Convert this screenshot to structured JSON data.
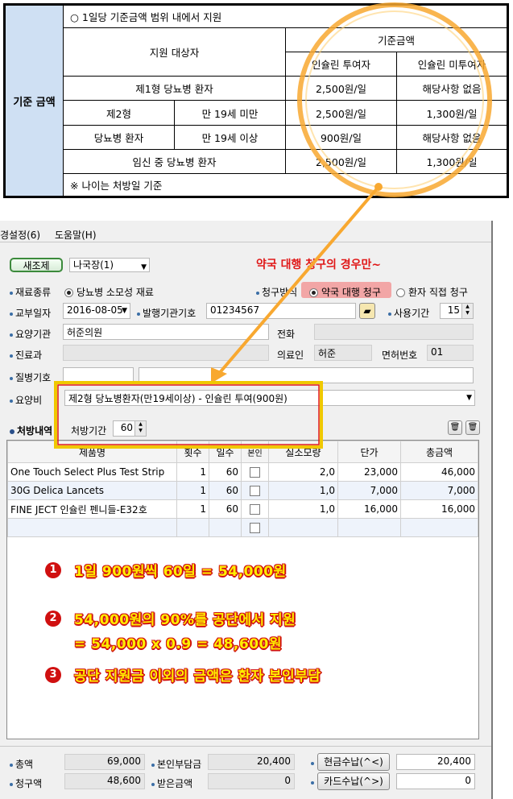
{
  "ref_table": {
    "side_label": "기준 금액",
    "note_top": "○ 1일당 기준금액 범위 내에서 지원",
    "header_target": "지원 대상자",
    "header_amount": "기준금액",
    "header_insulin_given": "인슐린 투여자",
    "header_insulin_not": "인슐린 미투여자",
    "rows": [
      {
        "a": "제1형 당뇨병 환자",
        "b": "",
        "c": "2,500원/일",
        "d": "해당사항 없음"
      },
      {
        "a": "제2형",
        "b": "만 19세 미만",
        "c": "2,500원/일",
        "d": "1,300원/일"
      },
      {
        "a": "당뇨병 환자",
        "b": "만 19세 이상",
        "c": "900원/일",
        "d": "해당사항 없음"
      },
      {
        "a": "임신 중 당뇨병 환자",
        "b": "",
        "c": "2,500원/일",
        "d": "1,300원/일"
      }
    ],
    "note_bottom": "※ 나이는 처방일 기준"
  },
  "menu": {
    "item1": "경설정(6)",
    "item2": "도움말(H)"
  },
  "toolbar": {
    "new_button": "새조제",
    "pharmacist": "나국장(1)"
  },
  "annotation_top": "약국 대행 청구의 경우만~",
  "form": {
    "material_type_label": "재료종류",
    "material_type_value": "당뇨병 소모성 재료",
    "claim_method_label": "청구방식",
    "claim_option1": "약국 대행 청구",
    "claim_option2": "환자 직접 청구",
    "issue_date_label": "교부일자",
    "issue_date": "2016-08-05",
    "issuer_code_label": "발행기관기호",
    "issuer_code": "01234567",
    "usage_period_label": "사용기간",
    "usage_period": "15",
    "institution_label": "요양기관",
    "institution": "허준의원",
    "phone_label": "전화",
    "phone": "",
    "department_label": "진료과",
    "department": "",
    "doctor_label": "의료인",
    "doctor": "허준",
    "license_label": "면허번호",
    "license": "01",
    "disease_label": "질병기호",
    "disease": "",
    "cost_label": "요양비",
    "cost_value": "제2형 당뇨병환자(만19세이상) - 인슐린 투여(900원)"
  },
  "rx": {
    "section_label": "처방내역",
    "period_label": "처방기간",
    "period_value": "60"
  },
  "grid": {
    "headers": [
      "제품명",
      "횟수",
      "일수",
      "본인",
      "실소모량",
      "단가",
      "총금액"
    ],
    "rows": [
      {
        "name": "One Touch Select Plus Test Strip",
        "times": "1",
        "days": "60",
        "qty": "2,0",
        "price": "23,000",
        "total": "46,000"
      },
      {
        "name": "30G Delica Lancets",
        "times": "1",
        "days": "60",
        "qty": "1,0",
        "price": "7,000",
        "total": "7,000"
      },
      {
        "name": "FINE JECT 인슐린 펜니들-E32호",
        "times": "1",
        "days": "60",
        "qty": "1,0",
        "price": "16,000",
        "total": "16,000"
      }
    ]
  },
  "notes": {
    "n1_badge": "1",
    "n1": "1일 900원씩 60일 = 54,000원",
    "n2_badge": "2",
    "n2a": "54,000원의 90%를 공단에서 지원",
    "n2b": "= 54,000 x 0.9 = 48,600원",
    "n3_badge": "3",
    "n3": "공단 지원금 이외의 금액은 환자 본인부담"
  },
  "summary": {
    "total_label": "총액",
    "total": "69,000",
    "patient_label": "본인부담금",
    "patient": "20,400",
    "claim_label": "청구액",
    "claim": "48,600",
    "received_label": "받은금액",
    "received": "0",
    "cash_button": "현금수납(^<)",
    "cash_value": "20,400",
    "card_button": "카드수납(^>)",
    "card_value": "0"
  },
  "colors": {
    "highlight_circle": "#f8a830",
    "arrow": "#f8a830",
    "annotation_red": "#e01818",
    "annotation_yellow": "#ffee00",
    "side_header": "#cfe0f3"
  }
}
